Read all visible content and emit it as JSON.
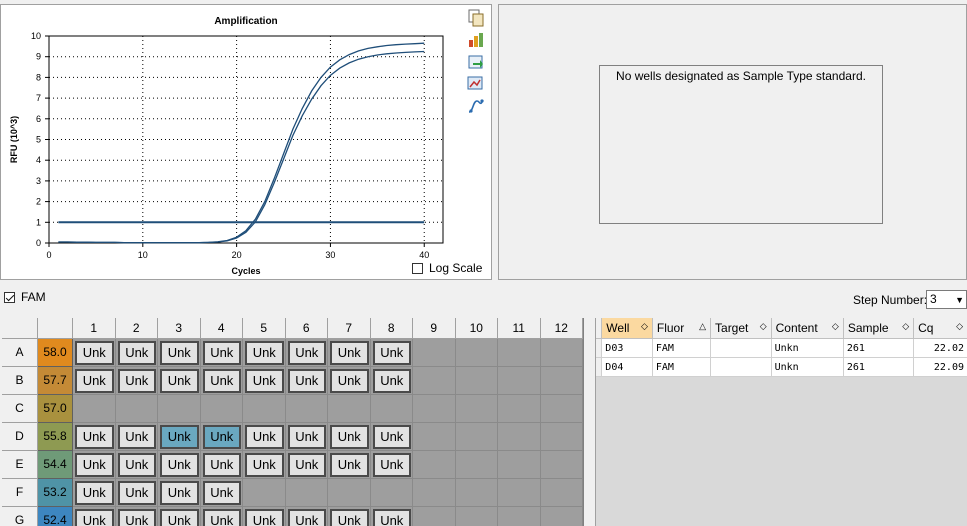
{
  "chart": {
    "title": "Amplification",
    "xlabel": "Cycles",
    "ylabel": "RFU (10^3)",
    "log_scale_label": "Log Scale",
    "log_scale_checked": false
  },
  "chart_data": {
    "type": "line",
    "title": "Amplification",
    "xlabel": "Cycles",
    "ylabel": "RFU (10^3)",
    "xlim": [
      0,
      42
    ],
    "ylim": [
      0,
      10
    ],
    "x_ticks": [
      0,
      10,
      20,
      30,
      40
    ],
    "y_ticks": [
      0,
      1,
      2,
      3,
      4,
      5,
      6,
      7,
      8,
      9,
      10
    ],
    "grid": true,
    "threshold": 1.0,
    "series": [
      {
        "x": [
          1,
          2,
          3,
          4,
          5,
          6,
          7,
          8,
          9,
          10,
          11,
          12,
          13,
          14,
          15,
          16,
          17,
          18,
          19,
          20,
          21,
          22,
          23,
          24,
          25,
          26,
          27,
          28,
          29,
          30,
          31,
          32,
          33,
          34,
          35,
          36,
          37,
          38,
          39,
          40
        ],
        "values": [
          0.05,
          0.05,
          0.04,
          0.04,
          0.03,
          0.03,
          0.03,
          0.02,
          0.02,
          0.02,
          0.02,
          0.02,
          0.02,
          0.02,
          0.02,
          0.02,
          0.03,
          0.06,
          0.12,
          0.28,
          0.6,
          1.15,
          2.0,
          3.1,
          4.3,
          5.5,
          6.5,
          7.35,
          8.0,
          8.5,
          8.85,
          9.1,
          9.28,
          9.4,
          9.48,
          9.54,
          9.58,
          9.61,
          9.63,
          9.65
        ]
      },
      {
        "x": [
          1,
          2,
          3,
          4,
          5,
          6,
          7,
          8,
          9,
          10,
          11,
          12,
          13,
          14,
          15,
          16,
          17,
          18,
          19,
          20,
          21,
          22,
          23,
          24,
          25,
          26,
          27,
          28,
          29,
          30,
          31,
          32,
          33,
          34,
          35,
          36,
          37,
          38,
          39,
          40
        ],
        "values": [
          0.05,
          0.05,
          0.04,
          0.04,
          0.03,
          0.03,
          0.03,
          0.02,
          0.02,
          0.02,
          0.02,
          0.02,
          0.02,
          0.02,
          0.02,
          0.02,
          0.03,
          0.05,
          0.1,
          0.24,
          0.52,
          1.02,
          1.85,
          2.9,
          4.05,
          5.2,
          6.15,
          6.95,
          7.6,
          8.1,
          8.45,
          8.7,
          8.88,
          9.0,
          9.08,
          9.14,
          9.18,
          9.21,
          9.23,
          9.25
        ]
      }
    ]
  },
  "toolbar": {
    "icons": [
      "copy-icon",
      "chart-options-icon",
      "export-icon",
      "zoom-icon",
      "trace-icon"
    ]
  },
  "standard_panel": {
    "message": "No wells designated as Sample Type standard."
  },
  "fluor_filter": {
    "label": "FAM",
    "checked": true
  },
  "step": {
    "label": "Step Number:",
    "value": "3"
  },
  "plate": {
    "columns": [
      "1",
      "2",
      "3",
      "4",
      "5",
      "6",
      "7",
      "8",
      "9",
      "10",
      "11",
      "12"
    ],
    "rows": [
      {
        "label": "A",
        "temp": "58.0",
        "color": "#e08a1e",
        "wells": [
          "Unk",
          "Unk",
          "Unk",
          "Unk",
          "Unk",
          "Unk",
          "Unk",
          "Unk",
          "",
          "",
          "",
          ""
        ],
        "selected": []
      },
      {
        "label": "B",
        "temp": "57.7",
        "color": "#c48a36",
        "wells": [
          "Unk",
          "Unk",
          "Unk",
          "Unk",
          "Unk",
          "Unk",
          "Unk",
          "Unk",
          "",
          "",
          "",
          ""
        ],
        "selected": []
      },
      {
        "label": "C",
        "temp": "57.0",
        "color": "#a9913e",
        "wells": [
          "",
          "",
          "",
          "",
          "",
          "",
          "",
          "",
          "",
          "",
          "",
          ""
        ],
        "selected": []
      },
      {
        "label": "D",
        "temp": "55.8",
        "color": "#8e9a52",
        "wells": [
          "Unk",
          "Unk",
          "Unk",
          "Unk",
          "Unk",
          "Unk",
          "Unk",
          "Unk",
          "",
          "",
          "",
          ""
        ],
        "selected": [
          2,
          3
        ]
      },
      {
        "label": "E",
        "temp": "54.4",
        "color": "#6f9a78",
        "wells": [
          "Unk",
          "Unk",
          "Unk",
          "Unk",
          "Unk",
          "Unk",
          "Unk",
          "Unk",
          "",
          "",
          "",
          ""
        ],
        "selected": []
      },
      {
        "label": "F",
        "temp": "53.2",
        "color": "#4f93a6",
        "wells": [
          "Unk",
          "Unk",
          "Unk",
          "Unk",
          "",
          "",
          "",
          "",
          "",
          "",
          "",
          ""
        ],
        "selected": []
      },
      {
        "label": "G",
        "temp": "52.4",
        "color": "#3d86c0",
        "wells": [
          "Unk",
          "Unk",
          "Unk",
          "Unk",
          "Unk",
          "Unk",
          "Unk",
          "Unk",
          "",
          "",
          "",
          ""
        ],
        "selected": []
      }
    ]
  },
  "results": {
    "headers": [
      "Well",
      "Fluor",
      "Target",
      "Content",
      "Sample",
      "Cq"
    ],
    "rows": [
      [
        "D03",
        "FAM",
        "",
        "Unkn",
        "261",
        "22.02"
      ],
      [
        "D04",
        "FAM",
        "",
        "Unkn",
        "261",
        "22.09"
      ]
    ]
  }
}
